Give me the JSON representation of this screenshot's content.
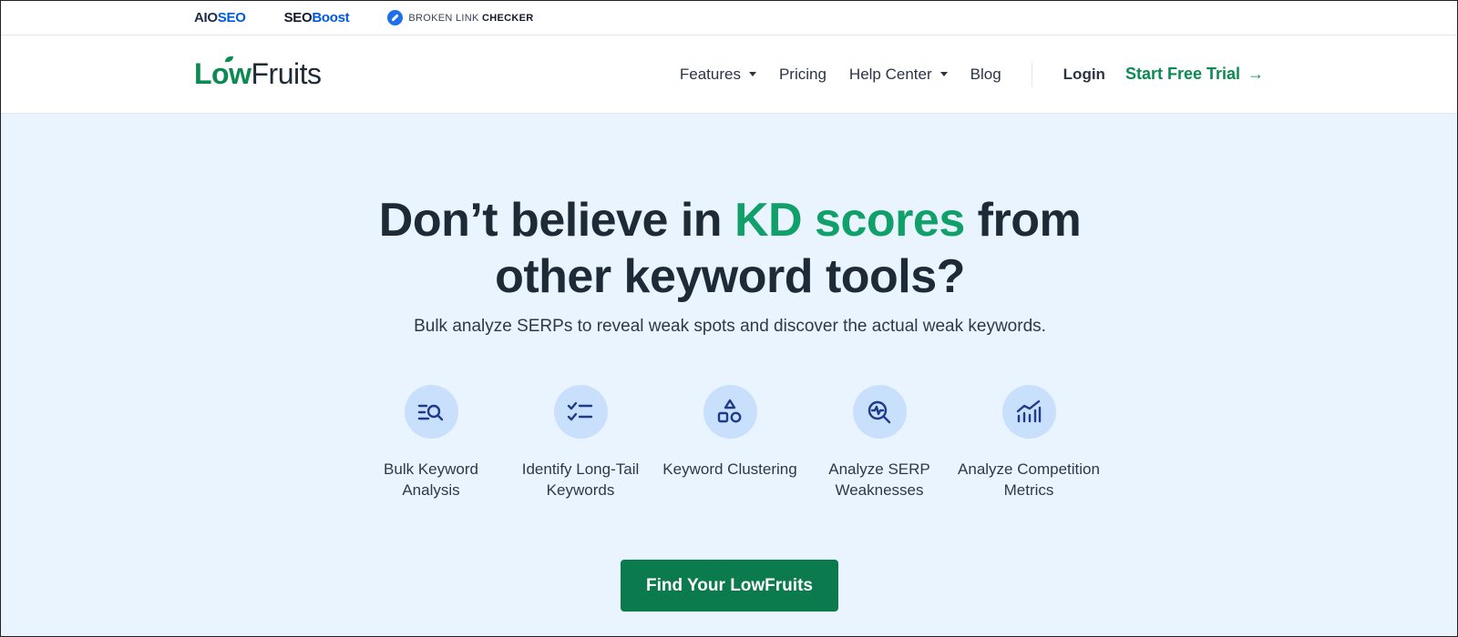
{
  "brandbar": {
    "aioseo": {
      "part1": "AIO",
      "part2": "SEO"
    },
    "seoboost": {
      "part1": "SEO",
      "part2": "Boost"
    },
    "blc": {
      "part1": "BROKEN LINK ",
      "part2": "CHECKER"
    }
  },
  "nav": {
    "logo": {
      "part1": "Low",
      "part2": "Fruits"
    },
    "links": [
      {
        "label": "Features",
        "has_dropdown": true
      },
      {
        "label": "Pricing",
        "has_dropdown": false
      },
      {
        "label": "Help Center",
        "has_dropdown": true
      },
      {
        "label": "Blog",
        "has_dropdown": false
      }
    ],
    "login": "Login",
    "trial": "Start Free Trial",
    "trial_arrow": "→"
  },
  "hero": {
    "headline_pre": "Don’t believe in ",
    "headline_accent": "KD scores",
    "headline_post": " from",
    "headline_line2": "other keyword tools?",
    "subtitle": "Bulk analyze SERPs to reveal weak spots and discover the actual weak keywords.",
    "features": [
      {
        "icon": "search-list-icon",
        "label": "Bulk Keyword Analysis"
      },
      {
        "icon": "checklist-icon",
        "label": "Identify Long-Tail Keywords"
      },
      {
        "icon": "shapes-icon",
        "label": "Keyword Clustering"
      },
      {
        "icon": "serp-analyze-icon",
        "label": "Analyze SERP Weaknesses"
      },
      {
        "icon": "chart-growth-icon",
        "label": "Analyze Competition Metrics"
      }
    ],
    "cta": "Find Your LowFruits"
  },
  "colors": {
    "accent_green": "#0b8a52",
    "headline_green": "#12a06a",
    "hero_bg": "#eaf4fe",
    "icon_circle": "#c9e0fd",
    "icon_stroke": "#1e3a8a",
    "cta_bg": "#0b7a4d"
  }
}
